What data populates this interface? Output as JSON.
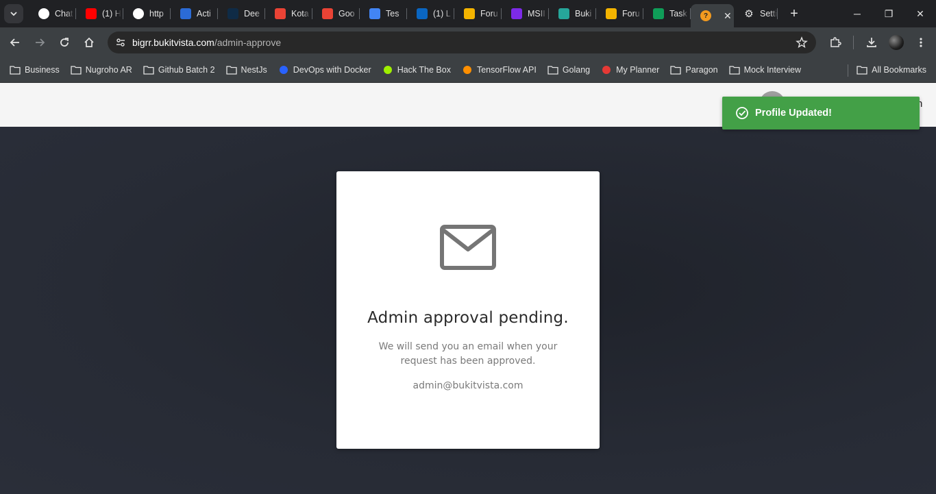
{
  "browser": {
    "tabs": [
      {
        "title": "Chat",
        "icon": "chatgpt-icon",
        "color": "#ffffff"
      },
      {
        "title": "(1) H",
        "icon": "youtube-icon",
        "color": "#ff0000"
      },
      {
        "title": "http",
        "icon": "google-icon",
        "color": "#ffffff"
      },
      {
        "title": "Acti",
        "icon": "activity-icon",
        "color": "#2b6bd6"
      },
      {
        "title": "Dee",
        "icon": "deepl-icon",
        "color": "#0f2b46"
      },
      {
        "title": "Kota",
        "icon": "gmail-icon",
        "color": "#ea4335"
      },
      {
        "title": "Goo",
        "icon": "gmail-icon",
        "color": "#ea4335"
      },
      {
        "title": "Tes",
        "icon": "docs-icon",
        "color": "#4285f4"
      },
      {
        "title": "(1) L",
        "icon": "linkedin-icon",
        "color": "#0a66c2"
      },
      {
        "title": "Foru",
        "icon": "classroom-icon",
        "color": "#f4b400"
      },
      {
        "title": "MSII",
        "icon": "canva-icon",
        "color": "#7d2ae8"
      },
      {
        "title": "Buki",
        "icon": "bukitvista-icon",
        "color": "#26a69a"
      },
      {
        "title": "Foru",
        "icon": "classroom-icon",
        "color": "#f4b400"
      },
      {
        "title": "Task",
        "icon": "classroom-icon",
        "color": "#0f9d58"
      }
    ],
    "active_tab_icon_color": "#f29a1f",
    "settings_tab": "Setti",
    "url_host": "bigrr.bukitvista.com",
    "url_path": "/admin-approve",
    "bookmarks": [
      {
        "label": "Business",
        "icon": "folder-icon"
      },
      {
        "label": "Nugroho AR",
        "icon": "folder-icon"
      },
      {
        "label": "Github Batch 2",
        "icon": "folder-icon"
      },
      {
        "label": "NestJs",
        "icon": "folder-icon"
      },
      {
        "label": "DevOps with Docker",
        "icon": "devops-icon"
      },
      {
        "label": "Hack The Box",
        "icon": "htb-icon"
      },
      {
        "label": "TensorFlow API",
        "icon": "tensorflow-icon"
      },
      {
        "label": "Golang",
        "icon": "folder-icon"
      },
      {
        "label": "My Planner",
        "icon": "planner-icon"
      },
      {
        "label": "Paragon",
        "icon": "folder-icon"
      },
      {
        "label": "Mock Interview",
        "icon": "folder-icon"
      }
    ],
    "all_bookmarks": "All Bookmarks"
  },
  "header": {
    "name_fragment": "n"
  },
  "card": {
    "title": "Admin approval pending.",
    "message": "We will send you an email when your request has been approved.",
    "email": "admin@bukitvista.com"
  },
  "toast": {
    "message": "Profile Updated!",
    "color": "#43a047"
  }
}
